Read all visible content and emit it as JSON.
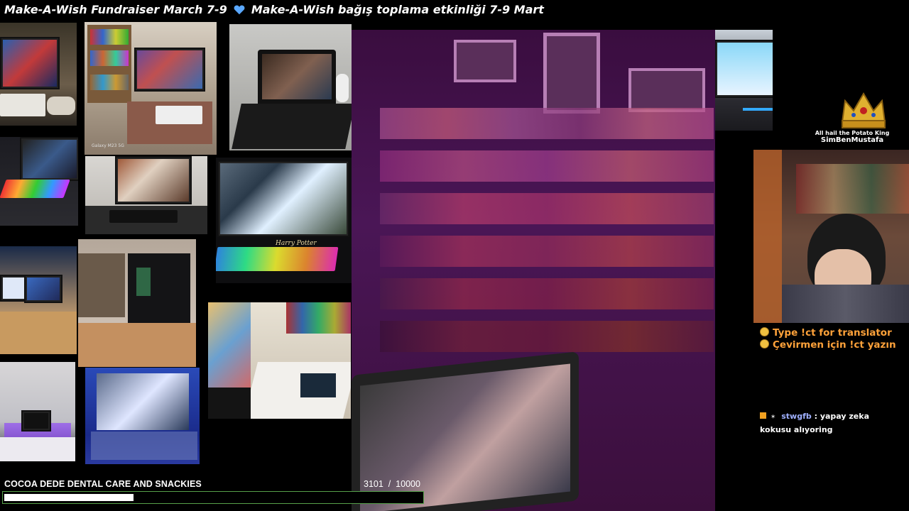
{
  "banner": {
    "text_en": "Make-A-Wish Fundraiser March 7-9",
    "text_tr": "Make-A-Wish bağış toplama etkinliği 7-9 Mart",
    "heart_icon": "blue-heart-icon",
    "heart_color": "#5aa8ff"
  },
  "photos": {
    "galaxy_caption": "Galaxy M23 5G",
    "harry_potter_text": "Harry Potter"
  },
  "streamer": {
    "title_small": "All hail the Potato King",
    "name": "SimBenMustafa"
  },
  "translator": {
    "line_en": "Type !ct for translator",
    "line_tr": "Çevirmen için !ct yazın",
    "color": "#ffa23a"
  },
  "chat": {
    "messages": [
      {
        "user": "stwgfb",
        "separator": ":",
        "text": "yapay zeka kokusu alıyoring"
      }
    ]
  },
  "donation": {
    "title": "COCOA DEDE DENTAL CARE AND SNACKIES",
    "current": 3101,
    "goal": 10000,
    "count_text": "3101  /  10000",
    "fill_fraction": 0.3101,
    "bar_border_color": "#56a04a"
  }
}
